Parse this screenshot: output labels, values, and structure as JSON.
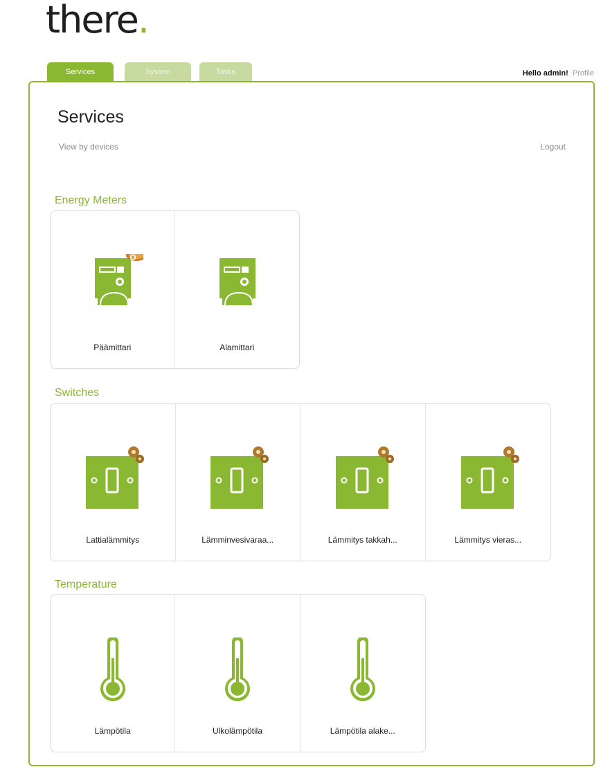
{
  "brand": {
    "logo_text": "there",
    "logo_dot": ".",
    "accent": "#8bb832"
  },
  "tabs": [
    {
      "label": "Services",
      "active": true
    },
    {
      "label": "System",
      "active": false
    },
    {
      "label": "Tasks",
      "active": false
    }
  ],
  "user": {
    "greeting": "Hello admin!",
    "profile_label": "Profile"
  },
  "page": {
    "title": "Services",
    "view_link": "View by devices",
    "logout": "Logout"
  },
  "sections": [
    {
      "title": "Energy Meters",
      "items": [
        {
          "label": "Päämittari",
          "icon": "energy-meter-icon",
          "badge": "O"
        },
        {
          "label": "Alamittari",
          "icon": "energy-meter-icon"
        }
      ]
    },
    {
      "title": "Switches",
      "items": [
        {
          "label": "Lattialämmitys",
          "icon": "switch-icon"
        },
        {
          "label": "Lämminvesivaraa...",
          "icon": "switch-icon"
        },
        {
          "label": "Lämmitys takkah...",
          "icon": "switch-icon"
        },
        {
          "label": "Lämmitys vieras...",
          "icon": "switch-icon"
        }
      ]
    },
    {
      "title": "Temperature",
      "items": [
        {
          "label": "Lämpötila",
          "icon": "thermometer-icon"
        },
        {
          "label": "Ulkolämpötila",
          "icon": "thermometer-icon"
        },
        {
          "label": "Lämpötila alake...",
          "icon": "thermometer-icon"
        }
      ]
    }
  ]
}
